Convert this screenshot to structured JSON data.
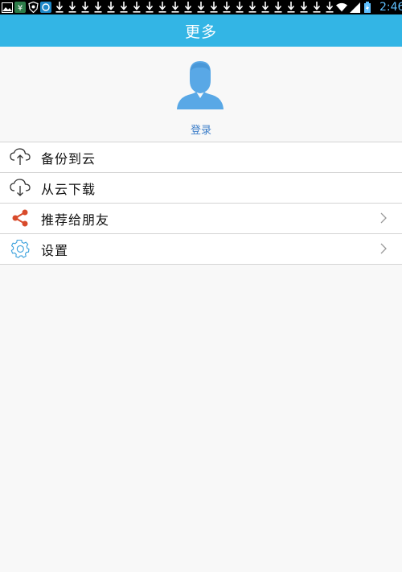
{
  "status_bar": {
    "time": "2:46",
    "left_icons": [
      "gallery-icon",
      "app-icon",
      "shield-icon",
      "browser-icon"
    ],
    "download_count": 22
  },
  "title_bar": {
    "title": "更多"
  },
  "profile": {
    "login_label": "登录"
  },
  "menu": {
    "items": [
      {
        "label": "备份到云",
        "icon": "cloud-upload-icon",
        "has_chevron": false
      },
      {
        "label": "从云下载",
        "icon": "cloud-download-icon",
        "has_chevron": false
      },
      {
        "label": "推荐给朋友",
        "icon": "share-icon",
        "has_chevron": true
      },
      {
        "label": "设置",
        "icon": "gear-icon",
        "has_chevron": true
      }
    ]
  },
  "colors": {
    "title_bar": "#33b5e5",
    "avatar": "#59a8e6",
    "login_link": "#3d7ec9",
    "share_icon": "#d84a2b",
    "gear_icon": "#3aa0dc"
  }
}
